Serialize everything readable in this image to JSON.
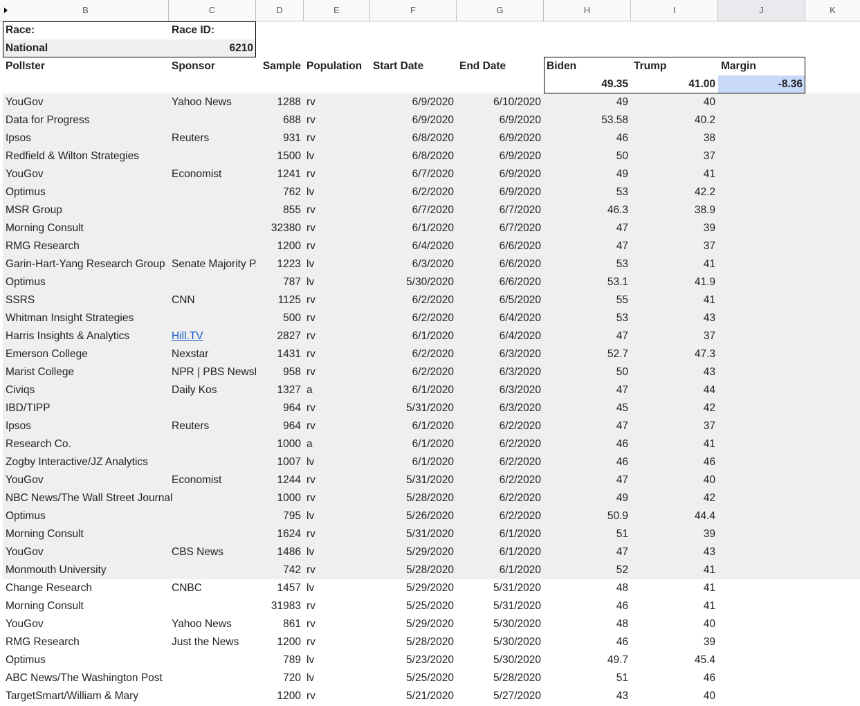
{
  "columns": [
    "B",
    "C",
    "D",
    "E",
    "F",
    "G",
    "H",
    "I",
    "J",
    "K"
  ],
  "header": {
    "race_label": "Race:",
    "race_id_label": "Race ID:",
    "race_value": "National",
    "race_id_value": "6210",
    "pollster": "Pollster",
    "sponsor": "Sponsor",
    "sample": "Sample",
    "population": "Population",
    "start_date": "Start Date",
    "end_date": "End Date",
    "biden": "Biden",
    "trump": "Trump",
    "margin": "Margin",
    "biden_avg": "49.35",
    "trump_avg": "41.00",
    "margin_avg": "-8.36"
  },
  "rows": [
    {
      "pollster": "YouGov",
      "sponsor": "Yahoo News",
      "sample": "1288",
      "population": "rv",
      "start": "6/9/2020",
      "end": "6/10/2020",
      "biden": "49",
      "trump": "40"
    },
    {
      "pollster": "Data for Progress",
      "sponsor": "",
      "sample": "688",
      "population": "rv",
      "start": "6/9/2020",
      "end": "6/9/2020",
      "biden": "53.58",
      "trump": "40.2"
    },
    {
      "pollster": "Ipsos",
      "sponsor": "Reuters",
      "sample": "931",
      "population": "rv",
      "start": "6/8/2020",
      "end": "6/9/2020",
      "biden": "46",
      "trump": "38"
    },
    {
      "pollster": "Redfield & Wilton Strategies",
      "sponsor": "",
      "sample": "1500",
      "population": "lv",
      "start": "6/8/2020",
      "end": "6/9/2020",
      "biden": "50",
      "trump": "37"
    },
    {
      "pollster": "YouGov",
      "sponsor": "Economist",
      "sample": "1241",
      "population": "rv",
      "start": "6/7/2020",
      "end": "6/9/2020",
      "biden": "49",
      "trump": "41"
    },
    {
      "pollster": "Optimus",
      "sponsor": "",
      "sample": "762",
      "population": "lv",
      "start": "6/2/2020",
      "end": "6/9/2020",
      "biden": "53",
      "trump": "42.2"
    },
    {
      "pollster": "MSR Group",
      "sponsor": "",
      "sample": "855",
      "population": "rv",
      "start": "6/7/2020",
      "end": "6/7/2020",
      "biden": "46.3",
      "trump": "38.9"
    },
    {
      "pollster": "Morning Consult",
      "sponsor": "",
      "sample": "32380",
      "population": "rv",
      "start": "6/1/2020",
      "end": "6/7/2020",
      "biden": "47",
      "trump": "39"
    },
    {
      "pollster": "RMG Research",
      "sponsor": "",
      "sample": "1200",
      "population": "rv",
      "start": "6/4/2020",
      "end": "6/6/2020",
      "biden": "47",
      "trump": "37"
    },
    {
      "pollster": "Garin-Hart-Yang Research Group",
      "sponsor": "Senate Majority PAC",
      "sample": "1223",
      "population": "lv",
      "start": "6/3/2020",
      "end": "6/6/2020",
      "biden": "53",
      "trump": "41"
    },
    {
      "pollster": "Optimus",
      "sponsor": "",
      "sample": "787",
      "population": "lv",
      "start": "5/30/2020",
      "end": "6/6/2020",
      "biden": "53.1",
      "trump": "41.9"
    },
    {
      "pollster": "SSRS",
      "sponsor": "CNN",
      "sample": "1125",
      "population": "rv",
      "start": "6/2/2020",
      "end": "6/5/2020",
      "biden": "55",
      "trump": "41"
    },
    {
      "pollster": "Whitman Insight Strategies",
      "sponsor": "",
      "sample": "500",
      "population": "rv",
      "start": "6/2/2020",
      "end": "6/4/2020",
      "biden": "53",
      "trump": "43"
    },
    {
      "pollster": "Harris Insights & Analytics",
      "sponsor": "Hill.TV",
      "sample": "2827",
      "population": "rv",
      "start": "6/1/2020",
      "end": "6/4/2020",
      "biden": "47",
      "trump": "37"
    },
    {
      "pollster": "Emerson College",
      "sponsor": "Nexstar",
      "sample": "1431",
      "population": "rv",
      "start": "6/2/2020",
      "end": "6/3/2020",
      "biden": "52.7",
      "trump": "47.3"
    },
    {
      "pollster": "Marist College",
      "sponsor": "NPR | PBS NewsHour",
      "sample": "958",
      "population": "rv",
      "start": "6/2/2020",
      "end": "6/3/2020",
      "biden": "50",
      "trump": "43"
    },
    {
      "pollster": "Civiqs",
      "sponsor": "Daily Kos",
      "sample": "1327",
      "population": "a",
      "start": "6/1/2020",
      "end": "6/3/2020",
      "biden": "47",
      "trump": "44"
    },
    {
      "pollster": "IBD/TIPP",
      "sponsor": "",
      "sample": "964",
      "population": "rv",
      "start": "5/31/2020",
      "end": "6/3/2020",
      "biden": "45",
      "trump": "42"
    },
    {
      "pollster": "Ipsos",
      "sponsor": "Reuters",
      "sample": "964",
      "population": "rv",
      "start": "6/1/2020",
      "end": "6/2/2020",
      "biden": "47",
      "trump": "37"
    },
    {
      "pollster": "Research Co.",
      "sponsor": "",
      "sample": "1000",
      "population": "a",
      "start": "6/1/2020",
      "end": "6/2/2020",
      "biden": "46",
      "trump": "41"
    },
    {
      "pollster": "Zogby Interactive/JZ Analytics",
      "sponsor": "",
      "sample": "1007",
      "population": "lv",
      "start": "6/1/2020",
      "end": "6/2/2020",
      "biden": "46",
      "trump": "46"
    },
    {
      "pollster": "YouGov",
      "sponsor": "Economist",
      "sample": "1244",
      "population": "rv",
      "start": "5/31/2020",
      "end": "6/2/2020",
      "biden": "47",
      "trump": "40"
    },
    {
      "pollster": "NBC News/The Wall Street Journal",
      "sponsor": "",
      "sample": "1000",
      "population": "rv",
      "start": "5/28/2020",
      "end": "6/2/2020",
      "biden": "49",
      "trump": "42"
    },
    {
      "pollster": "Optimus",
      "sponsor": "",
      "sample": "795",
      "population": "lv",
      "start": "5/26/2020",
      "end": "6/2/2020",
      "biden": "50.9",
      "trump": "44.4"
    },
    {
      "pollster": "Morning Consult",
      "sponsor": "",
      "sample": "1624",
      "population": "rv",
      "start": "5/31/2020",
      "end": "6/1/2020",
      "biden": "51",
      "trump": "39"
    },
    {
      "pollster": "YouGov",
      "sponsor": "CBS News",
      "sample": "1486",
      "population": "lv",
      "start": "5/29/2020",
      "end": "6/1/2020",
      "biden": "47",
      "trump": "43"
    },
    {
      "pollster": "Monmouth University",
      "sponsor": "",
      "sample": "742",
      "population": "rv",
      "start": "5/28/2020",
      "end": "6/1/2020",
      "biden": "52",
      "trump": "41"
    },
    {
      "pollster": "Change Research",
      "sponsor": "CNBC",
      "sample": "1457",
      "population": "lv",
      "start": "5/29/2020",
      "end": "5/31/2020",
      "biden": "48",
      "trump": "41"
    },
    {
      "pollster": "Morning Consult",
      "sponsor": "",
      "sample": "31983",
      "population": "rv",
      "start": "5/25/2020",
      "end": "5/31/2020",
      "biden": "46",
      "trump": "41"
    },
    {
      "pollster": "YouGov",
      "sponsor": "Yahoo News",
      "sample": "861",
      "population": "rv",
      "start": "5/29/2020",
      "end": "5/30/2020",
      "biden": "48",
      "trump": "40"
    },
    {
      "pollster": "RMG Research",
      "sponsor": "Just the News",
      "sample": "1200",
      "population": "rv",
      "start": "5/28/2020",
      "end": "5/30/2020",
      "biden": "46",
      "trump": "39"
    },
    {
      "pollster": "Optimus",
      "sponsor": "",
      "sample": "789",
      "population": "lv",
      "start": "5/23/2020",
      "end": "5/30/2020",
      "biden": "49.7",
      "trump": "45.4"
    },
    {
      "pollster": "ABC News/The Washington Post",
      "sponsor": "",
      "sample": "720",
      "population": "lv",
      "start": "5/25/2020",
      "end": "5/28/2020",
      "biden": "51",
      "trump": "46"
    },
    {
      "pollster": "TargetSmart/William & Mary",
      "sponsor": "",
      "sample": "1200",
      "population": "rv",
      "start": "5/21/2020",
      "end": "5/27/2020",
      "biden": "43",
      "trump": "40"
    }
  ],
  "link_sponsors": [
    "Hill.TV"
  ],
  "gray_row_count": 27
}
